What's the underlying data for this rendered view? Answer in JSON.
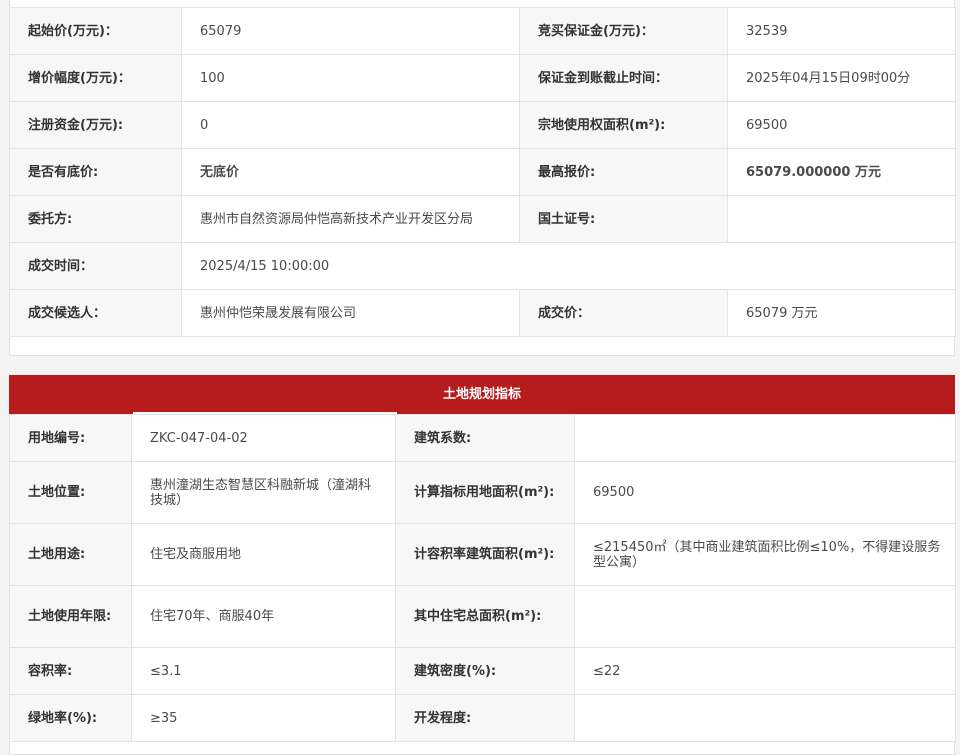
{
  "auction": {
    "rows": [
      {
        "l1": "起始价(万元)：",
        "v1": "65079",
        "l2": "竞买保证金(万元)：",
        "v2": "32539"
      },
      {
        "l1": "增价幅度(万元)：",
        "v1": "100",
        "l2": "保证金到账截止时间：",
        "v2": "2025年04月15日09时00分"
      },
      {
        "l1": "注册资金(万元):",
        "v1": "0",
        "l2": "宗地使用权面积(m²):",
        "v2": "69500"
      },
      {
        "l1": "是否有底价:",
        "v1": "无底价",
        "l2": "最高报价:",
        "v2": "65079.000000 万元"
      },
      {
        "l1": "委托方:",
        "v1": "惠州市自然资源局仲恺高新技术产业开发区分局",
        "l2": "国土证号:",
        "v2": ""
      }
    ],
    "deal_time": {
      "label": "成交时间：",
      "value": "2025/4/15 10:00:00"
    },
    "deal": {
      "l1": "成交候选人：",
      "v1": "惠州仲恺荣晟发展有限公司",
      "l2": "成交价：",
      "v2": "65079 万元"
    }
  },
  "plan": {
    "title": "土地规划指标",
    "rows": [
      {
        "l1": "用地编号:",
        "v1": "ZKC-047-04-02",
        "l2": "建筑系数:",
        "v2": ""
      },
      {
        "l1": "土地位置:",
        "v1": "惠州潼湖生态智慧区科融新城（潼湖科技城）",
        "l2": "计算指标用地面积(m²):",
        "v2": "69500"
      },
      {
        "l1": "土地用途:",
        "v1": "住宅及商服用地",
        "l2": "计容积率建筑面积(m²):",
        "v2": "≤215450㎡（其中商业建筑面积比例≤10%，不得建设服务型公寓）"
      },
      {
        "l1": "土地使用年限:",
        "v1": "住宅70年、商服40年",
        "l2": "其中住宅总面积(m²):",
        "v2": ""
      },
      {
        "l1": "容积率:",
        "v1": "≤3.1",
        "l2": "建筑密度(%):",
        "v2": "≤22"
      },
      {
        "l1": "绿地率(%):",
        "v1": "≥35",
        "l2": "开发程度:",
        "v2": ""
      }
    ]
  }
}
